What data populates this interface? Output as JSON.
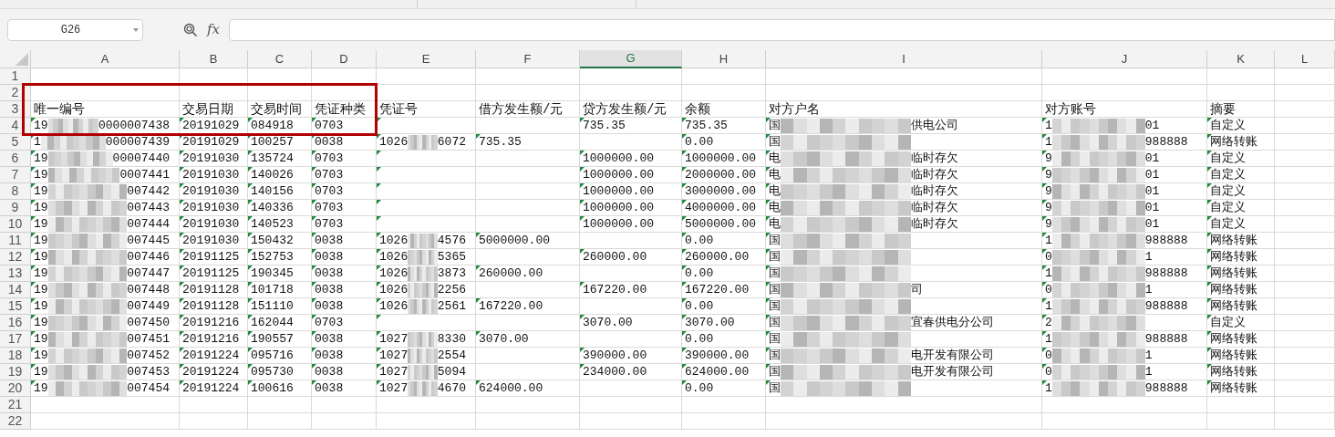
{
  "name_box": {
    "value": "G26"
  },
  "formula_bar": {
    "label": "fx"
  },
  "columns": [
    {
      "label": "A",
      "selected": false
    },
    {
      "label": "B",
      "selected": false
    },
    {
      "label": "C",
      "selected": false
    },
    {
      "label": "D",
      "selected": false
    },
    {
      "label": "E",
      "selected": false
    },
    {
      "label": "F",
      "selected": false
    },
    {
      "label": "G",
      "selected": true
    },
    {
      "label": "H",
      "selected": false
    },
    {
      "label": "I",
      "selected": false
    },
    {
      "label": "J",
      "selected": false
    },
    {
      "label": "K",
      "selected": false
    },
    {
      "label": "L",
      "selected": false
    }
  ],
  "rows": [
    {
      "number": "1",
      "cells": []
    },
    {
      "number": "2",
      "cells": []
    },
    {
      "number": "3",
      "kind": "header",
      "cells": [
        {
          "text": "唯一编号"
        },
        {
          "text": "交易日期"
        },
        {
          "text": "交易时间"
        },
        {
          "text": "凭证种类"
        },
        {
          "text": "凭证号"
        },
        {
          "text": "借方发生额/元"
        },
        {
          "text": "贷方发生额/元"
        },
        {
          "text": "余额"
        },
        {
          "text": "对方户名"
        },
        {
          "text": "对方账号"
        },
        {
          "text": "摘要"
        }
      ]
    },
    {
      "number": "4",
      "kind": "data",
      "cells": [
        {
          "start": "19",
          "end": "0000007438"
        },
        {
          "text": "20191029"
        },
        {
          "text": "084918"
        },
        {
          "text": "0703"
        },
        {},
        null,
        {
          "text": "735.35"
        },
        {
          "text": "735.35"
        },
        {
          "start": "国",
          "end": "供电公司"
        },
        {
          "start": "1",
          "end": "01"
        },
        {
          "text": "自定义"
        }
      ]
    },
    {
      "number": "5",
      "kind": "data",
      "cells": [
        {
          "start": "1",
          "end": "000007439"
        },
        {
          "text": "20191029"
        },
        {
          "text": "100257"
        },
        {
          "text": "0038"
        },
        {
          "start": "1026",
          "end": "6072"
        },
        {
          "text": "735.35"
        },
        null,
        {
          "text": "0.00"
        },
        {
          "start": "国"
        },
        {
          "start": "1",
          "end": "988888"
        },
        {
          "text": "网络转账"
        }
      ]
    },
    {
      "number": "6",
      "kind": "data",
      "cells": [
        {
          "start": "19",
          "end": "00007440"
        },
        {
          "text": "20191030"
        },
        {
          "text": "135724"
        },
        {
          "text": "0703"
        },
        {},
        null,
        {
          "text": "1000000.00"
        },
        {
          "text": "1000000.00"
        },
        {
          "start": "电",
          "end": "临时存欠"
        },
        {
          "start": "9",
          "end": "01"
        },
        {
          "text": "自定义"
        }
      ]
    },
    {
      "number": "7",
      "kind": "data",
      "cells": [
        {
          "start": "19",
          "end": "0007441"
        },
        {
          "text": "20191030"
        },
        {
          "text": "140026"
        },
        {
          "text": "0703"
        },
        {},
        null,
        {
          "text": "1000000.00"
        },
        {
          "text": "2000000.00"
        },
        {
          "start": "电",
          "end": "临时存欠"
        },
        {
          "start": "9",
          "end": "01"
        },
        {
          "text": "自定义"
        }
      ]
    },
    {
      "number": "8",
      "kind": "data",
      "cells": [
        {
          "start": "19",
          "end": "007442"
        },
        {
          "text": "20191030"
        },
        {
          "text": "140156"
        },
        {
          "text": "0703"
        },
        {},
        null,
        {
          "text": "1000000.00"
        },
        {
          "text": "3000000.00"
        },
        {
          "start": "电",
          "end": "临时存欠"
        },
        {
          "start": "9",
          "end": "01"
        },
        {
          "text": "自定义"
        }
      ]
    },
    {
      "number": "9",
      "kind": "data",
      "cells": [
        {
          "start": "19",
          "end": "007443"
        },
        {
          "text": "20191030"
        },
        {
          "text": "140336"
        },
        {
          "text": "0703"
        },
        {},
        null,
        {
          "text": "1000000.00"
        },
        {
          "text": "4000000.00"
        },
        {
          "start": "电",
          "end": "临时存欠"
        },
        {
          "start": "9",
          "end": "01"
        },
        {
          "text": "自定义"
        }
      ]
    },
    {
      "number": "10",
      "kind": "data",
      "cells": [
        {
          "start": "19",
          "end": "007444"
        },
        {
          "text": "20191030"
        },
        {
          "text": "140523"
        },
        {
          "text": "0703"
        },
        {},
        null,
        {
          "text": "1000000.00"
        },
        {
          "text": "5000000.00"
        },
        {
          "start": "电",
          "end": "临时存欠"
        },
        {
          "start": "9",
          "end": "01"
        },
        {
          "text": "自定义"
        }
      ]
    },
    {
      "number": "11",
      "kind": "data",
      "cells": [
        {
          "start": "19",
          "end": "007445"
        },
        {
          "text": "20191030"
        },
        {
          "text": "150432"
        },
        {
          "text": "0038"
        },
        {
          "start": "1026",
          "end": "4576"
        },
        {
          "text": "5000000.00"
        },
        null,
        {
          "text": "0.00"
        },
        {
          "start": "国"
        },
        {
          "start": "1",
          "end": "988888"
        },
        {
          "text": "网络转账"
        }
      ]
    },
    {
      "number": "12",
      "kind": "data",
      "cells": [
        {
          "start": "19",
          "end": "007446"
        },
        {
          "text": "20191125"
        },
        {
          "text": "152753"
        },
        {
          "text": "0038"
        },
        {
          "start": "1026",
          "end": "5365"
        },
        null,
        {
          "text": "260000.00"
        },
        {
          "text": "260000.00"
        },
        {
          "start": "国"
        },
        {
          "start": "0",
          "end": "1"
        },
        {
          "text": "网络转账"
        }
      ]
    },
    {
      "number": "13",
      "kind": "data",
      "cells": [
        {
          "start": "19",
          "end": "007447"
        },
        {
          "text": "20191125"
        },
        {
          "text": "190345"
        },
        {
          "text": "0038"
        },
        {
          "start": "1026",
          "end": "3873"
        },
        {
          "text": "260000.00"
        },
        null,
        {
          "text": "0.00"
        },
        {
          "start": "国"
        },
        {
          "start": "1",
          "end": "988888"
        },
        {
          "text": "网络转账"
        }
      ]
    },
    {
      "number": "14",
      "kind": "data",
      "cells": [
        {
          "start": "19",
          "end": "007448"
        },
        {
          "text": "20191128"
        },
        {
          "text": "101718"
        },
        {
          "text": "0038"
        },
        {
          "start": "1026",
          "end": "2256"
        },
        null,
        {
          "text": "167220.00"
        },
        {
          "text": "167220.00"
        },
        {
          "start": "国",
          "end": "司"
        },
        {
          "start": "0",
          "end": "1"
        },
        {
          "text": "网络转账"
        }
      ]
    },
    {
      "number": "15",
      "kind": "data",
      "cells": [
        {
          "start": "19",
          "end": "007449"
        },
        {
          "text": "20191128"
        },
        {
          "text": "151110"
        },
        {
          "text": "0038"
        },
        {
          "start": "1026",
          "end": "2561"
        },
        {
          "text": "167220.00"
        },
        null,
        {
          "text": "0.00"
        },
        {
          "start": "国"
        },
        {
          "start": "1",
          "end": "988888"
        },
        {
          "text": "网络转账"
        }
      ]
    },
    {
      "number": "16",
      "kind": "data",
      "cells": [
        {
          "start": "19",
          "end": "007450"
        },
        {
          "text": "20191216"
        },
        {
          "text": "162044"
        },
        {
          "text": "0703"
        },
        {},
        null,
        {
          "text": "3070.00"
        },
        {
          "text": "3070.00"
        },
        {
          "start": "国",
          "end": "宜春供电分公司"
        },
        {
          "start": "2"
        },
        {
          "text": "自定义"
        }
      ]
    },
    {
      "number": "17",
      "kind": "data",
      "cells": [
        {
          "start": "19",
          "end": "007451"
        },
        {
          "text": "20191216"
        },
        {
          "text": "190557"
        },
        {
          "text": "0038"
        },
        {
          "start": "1027",
          "end": "8330"
        },
        {
          "text": "3070.00"
        },
        null,
        {
          "text": "0.00"
        },
        {
          "start": "国"
        },
        {
          "start": "1",
          "end": "988888"
        },
        {
          "text": "网络转账"
        }
      ]
    },
    {
      "number": "18",
      "kind": "data",
      "cells": [
        {
          "start": "19",
          "end": "007452"
        },
        {
          "text": "20191224"
        },
        {
          "text": "095716"
        },
        {
          "text": "0038"
        },
        {
          "start": "1027",
          "end": "2554"
        },
        null,
        {
          "text": "390000.00"
        },
        {
          "text": "390000.00"
        },
        {
          "start": "国",
          "end": "电开发有限公司"
        },
        {
          "start": "0",
          "end": "1"
        },
        {
          "text": "网络转账"
        }
      ]
    },
    {
      "number": "19",
      "kind": "data",
      "cells": [
        {
          "start": "19",
          "end": "007453"
        },
        {
          "text": "20191224"
        },
        {
          "text": "095730"
        },
        {
          "text": "0038"
        },
        {
          "start": "1027",
          "end": "5094"
        },
        null,
        {
          "text": "234000.00"
        },
        {
          "text": "624000.00"
        },
        {
          "start": "国",
          "end": "电开发有限公司"
        },
        {
          "start": "0",
          "end": "1"
        },
        {
          "text": "网络转账"
        }
      ]
    },
    {
      "number": "20",
      "kind": "data",
      "cells": [
        {
          "start": "19",
          "end": "007454"
        },
        {
          "text": "20191224"
        },
        {
          "text": "100616"
        },
        {
          "text": "0038"
        },
        {
          "start": "1027",
          "end": "4670"
        },
        {
          "text": "624000.00"
        },
        null,
        {
          "text": "0.00"
        },
        {
          "start": "国"
        },
        {
          "start": "1",
          "end": "988888"
        },
        {
          "text": "网络转账"
        }
      ]
    },
    {
      "number": "21",
      "cells": []
    },
    {
      "number": "22",
      "cells": []
    }
  ]
}
